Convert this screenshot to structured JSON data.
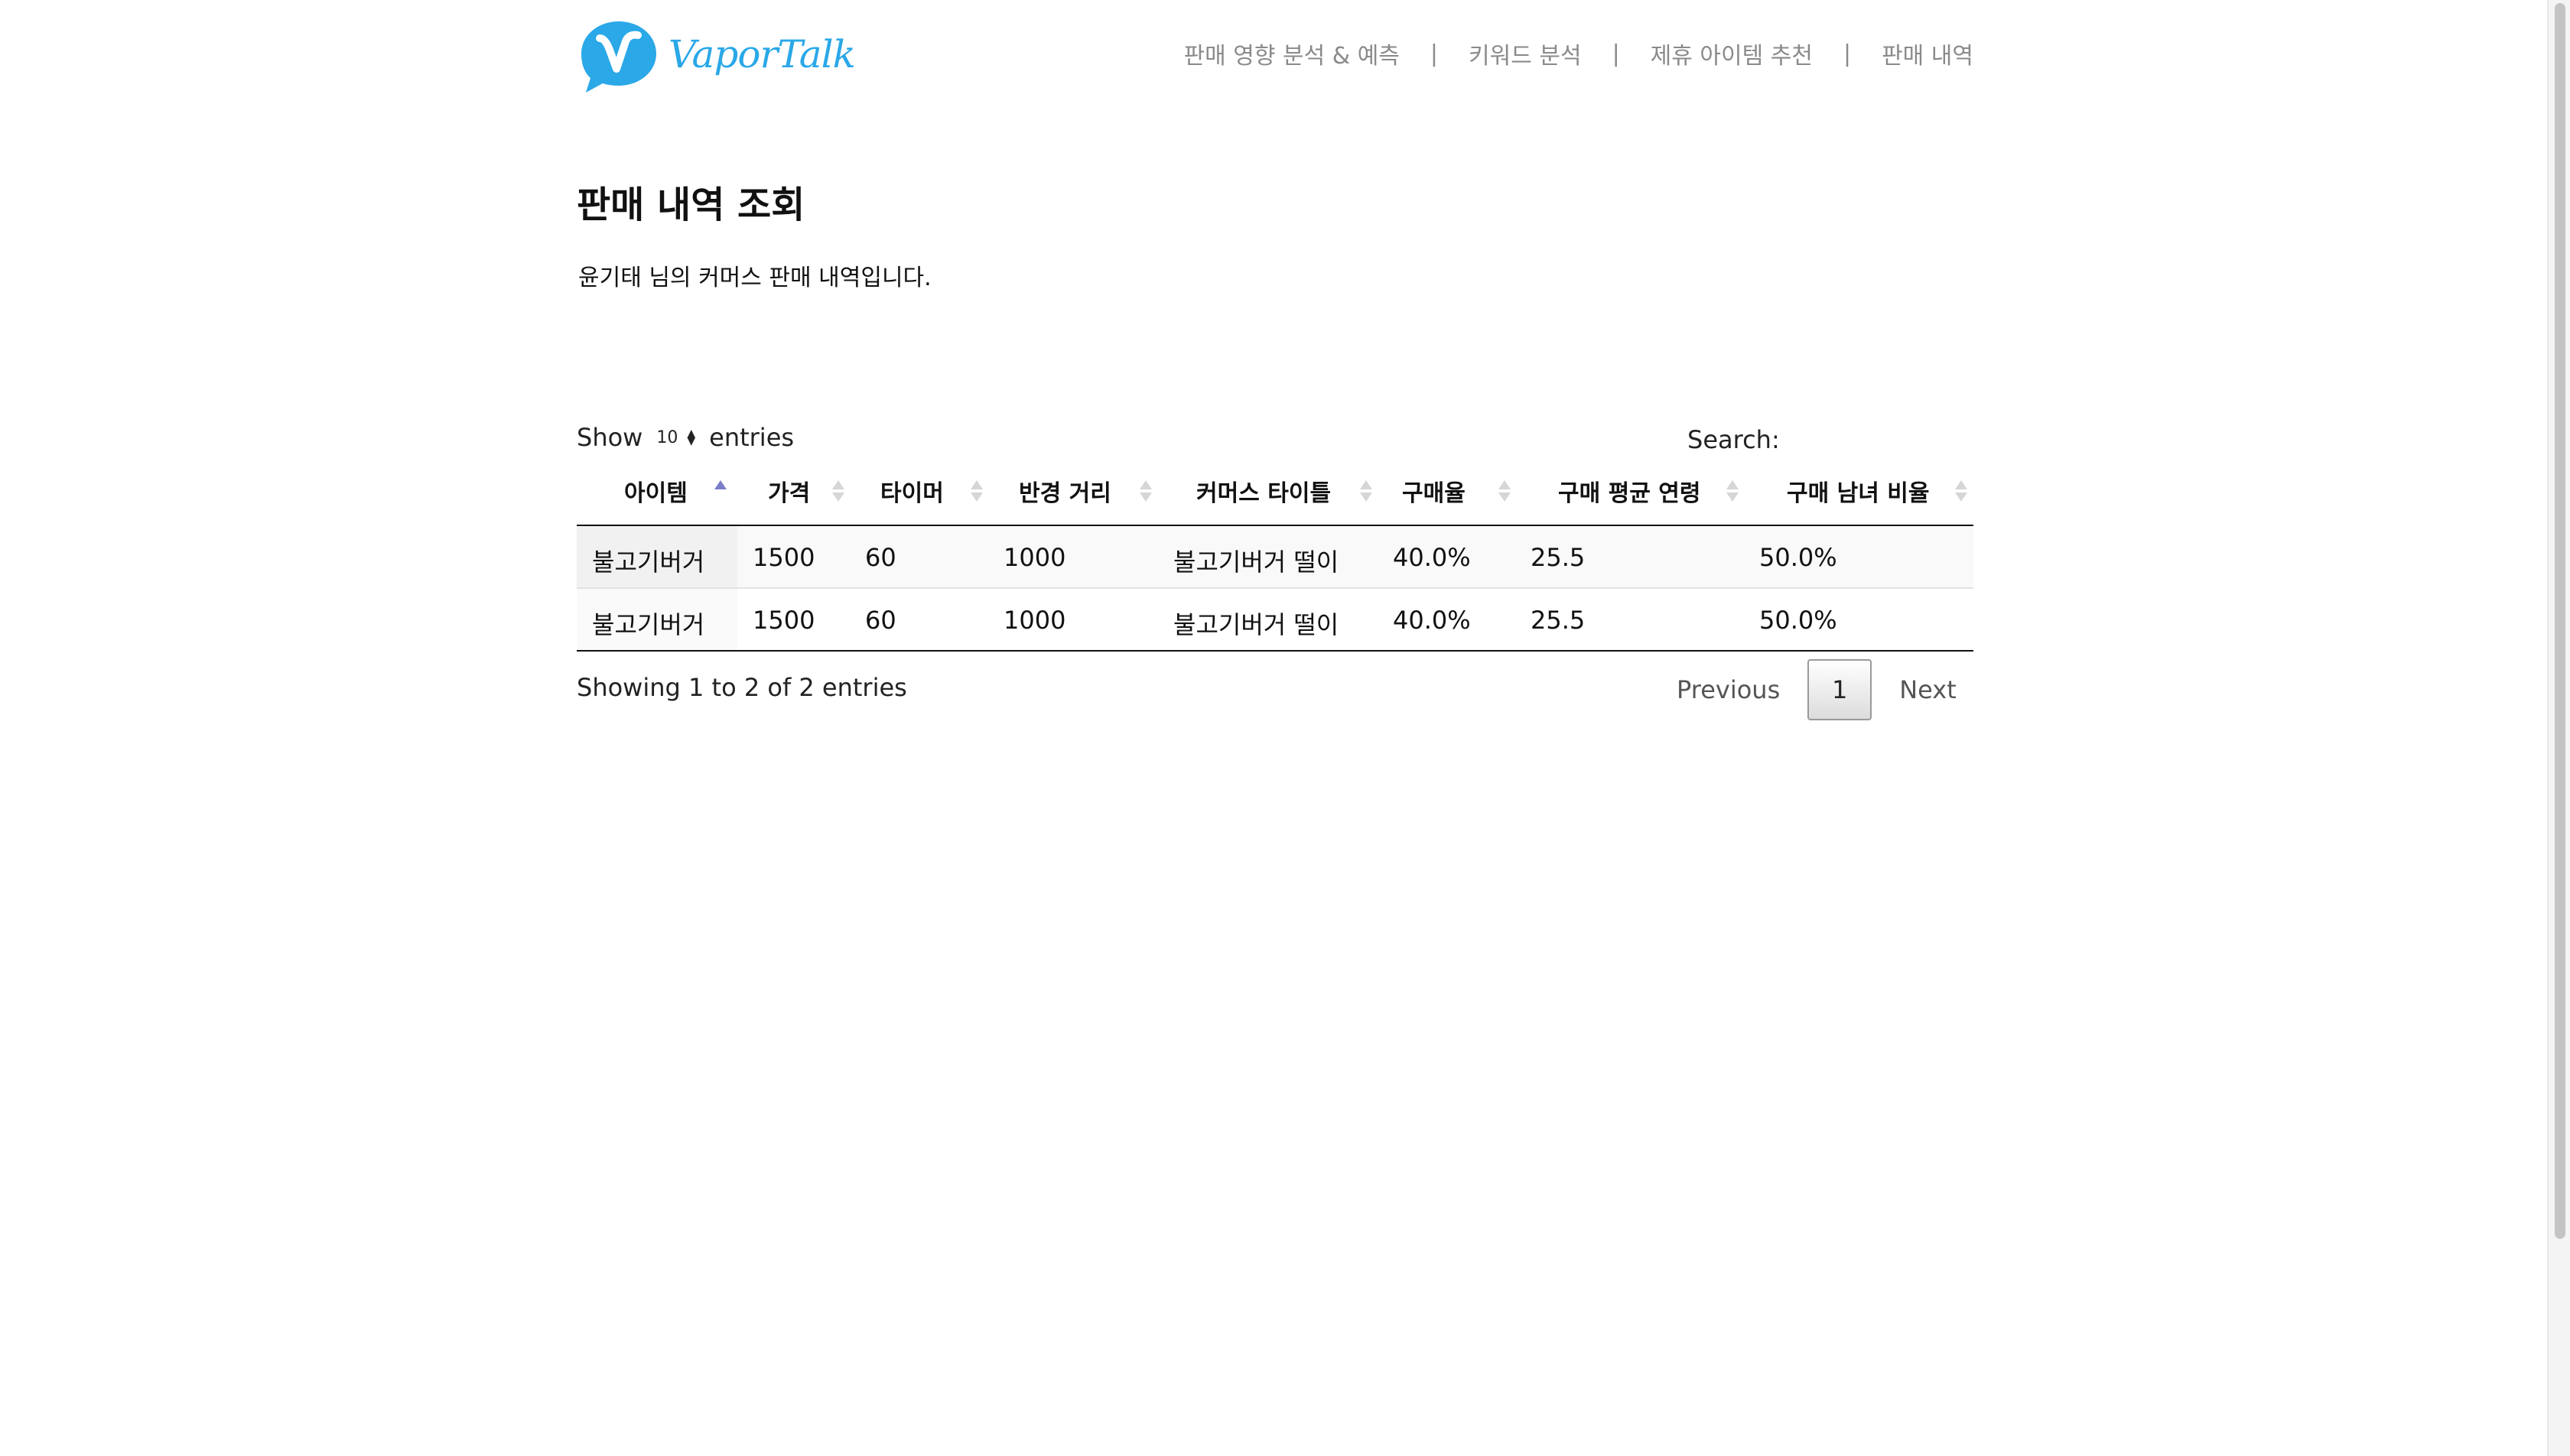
{
  "brand": {
    "name": "VaporTalk",
    "color": "#2aa8e8"
  },
  "nav": [
    {
      "label": "판매 영향 분석 & 예측"
    },
    {
      "label": "키워드 분석"
    },
    {
      "label": "제휴 아이템 추천"
    },
    {
      "label": "판매 내역"
    }
  ],
  "nav_separator": "|",
  "page": {
    "title": "판매 내역 조회",
    "subtitle": "윤기태 님의 커머스 판매 내역입니다."
  },
  "table_controls": {
    "show_label": "Show",
    "length_value": "10",
    "entries_label": "entries",
    "search_label": "Search:",
    "search_value": ""
  },
  "table": {
    "columns": [
      "아이템",
      "가격",
      "타이머",
      "반경 거리",
      "커머스 타이틀",
      "구매율",
      "구매 평균 연령",
      "구매 남녀 비율"
    ],
    "sorted_column": "아이템",
    "sort_direction": "ascending",
    "rows": [
      [
        "불고기버거",
        "1500",
        "60",
        "1000",
        "불고기버거 떨이",
        "40.0%",
        "25.5",
        "50.0%"
      ],
      [
        "불고기버거",
        "1500",
        "60",
        "1000",
        "불고기버거 떨이",
        "40.0%",
        "25.5",
        "50.0%"
      ]
    ]
  },
  "info": "Showing 1 to 2 of 2 entries",
  "pagination": {
    "previous": "Previous",
    "current": "1",
    "next": "Next"
  },
  "colors": {
    "sort_active": "#7b7fc9",
    "sort_inactive": "#d6d6d6",
    "nav_text": "#8a8a8a"
  }
}
